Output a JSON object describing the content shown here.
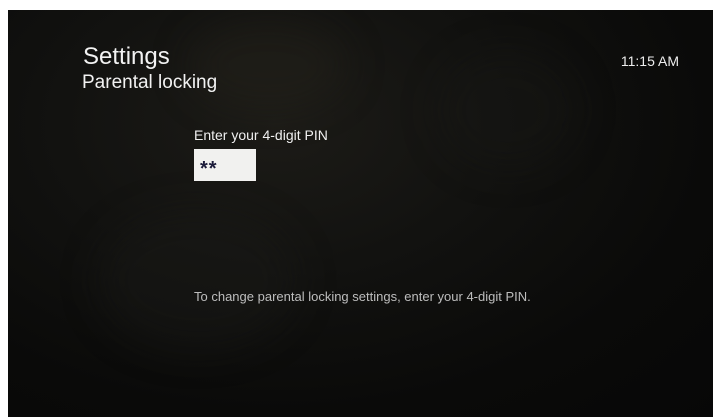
{
  "header": {
    "title": "Settings",
    "subtitle": "Parental locking",
    "time": "11:15 AM"
  },
  "pin": {
    "prompt": "Enter your 4-digit PIN",
    "masked_value": "**"
  },
  "footer": {
    "hint": "To change parental locking settings, enter your 4-digit PIN."
  }
}
